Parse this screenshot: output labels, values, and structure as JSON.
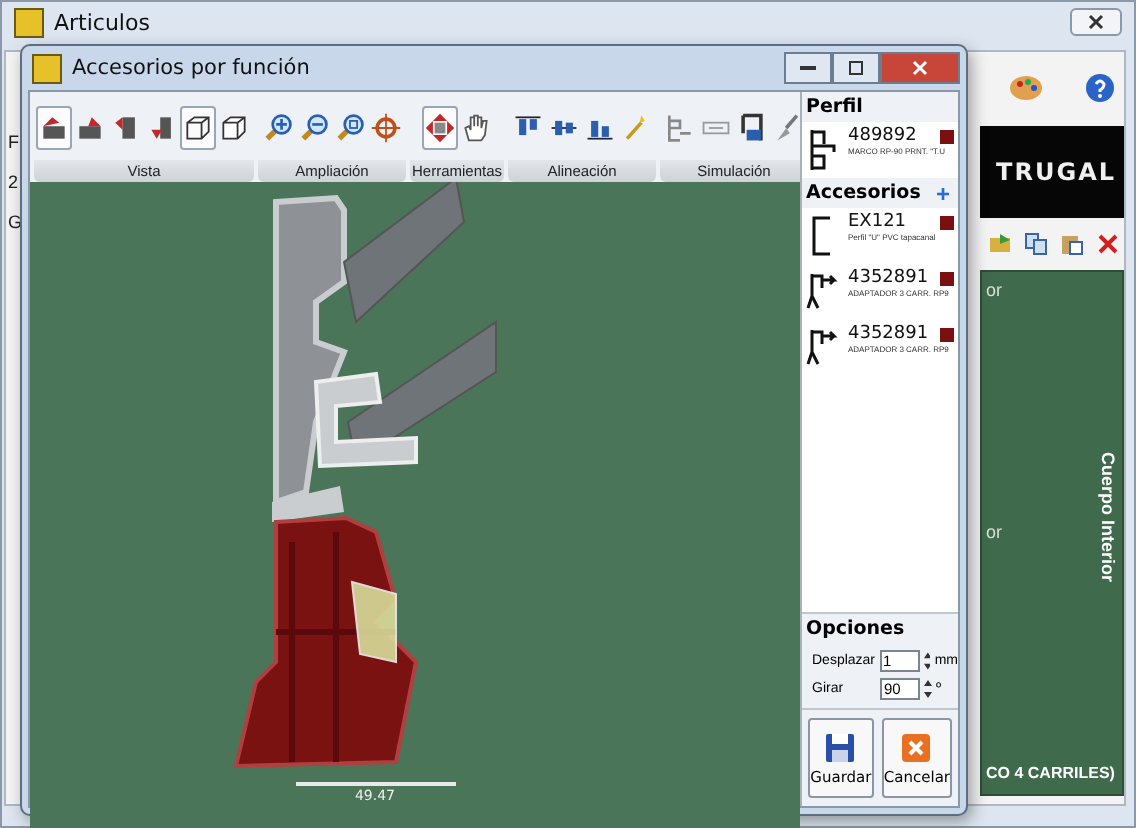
{
  "back_window": {
    "title": "Articulos",
    "left_labels": [
      "F",
      "2",
      "G"
    ],
    "logo": "TRUGAL",
    "panel": {
      "labels": [
        "or",
        "or"
      ],
      "side_title": "Cuerpo Interior",
      "caption": "CO 4 CARRILES)"
    }
  },
  "window": {
    "title": "Accesorios por función"
  },
  "toolbar": [
    {
      "label": "Vista",
      "buttons": [
        {
          "kind": "view-a",
          "selected": true
        },
        {
          "kind": "view-b",
          "selected": false
        },
        {
          "kind": "view-c",
          "selected": false
        },
        {
          "kind": "view-d",
          "selected": false
        },
        {
          "kind": "frame",
          "selected": true
        },
        {
          "kind": "cube",
          "selected": false
        }
      ]
    },
    {
      "label": "Ampliación",
      "buttons": [
        {
          "kind": "zoom-in",
          "selected": false
        },
        {
          "kind": "zoom-out",
          "selected": false
        },
        {
          "kind": "zoom-fit",
          "selected": false
        },
        {
          "kind": "target",
          "selected": false
        }
      ]
    },
    {
      "label": "Herramientas",
      "buttons": [
        {
          "kind": "move",
          "selected": true
        },
        {
          "kind": "hand",
          "selected": false
        }
      ]
    },
    {
      "label": "Alineación",
      "buttons": [
        {
          "kind": "align-top",
          "selected": false
        },
        {
          "kind": "align-mid",
          "selected": false
        },
        {
          "kind": "align-bottom",
          "selected": false
        },
        {
          "kind": "wand",
          "selected": false
        }
      ]
    },
    {
      "label": "Simulación",
      "buttons": [
        {
          "kind": "sim-a",
          "selected": false
        },
        {
          "kind": "sim-b",
          "selected": false
        },
        {
          "kind": "sim-c",
          "selected": false
        },
        {
          "kind": "brush",
          "selected": false
        }
      ]
    }
  ],
  "canvas": {
    "dimension": "49.47"
  },
  "perfil": {
    "title": "Perfil",
    "item": {
      "code": "489892",
      "desc": "MARCO RP-90 PRNT. \"T.U",
      "color": "#7a1010"
    }
  },
  "accesorios": {
    "title": "Accesorios",
    "add_button": "+",
    "items": [
      {
        "kind": "u",
        "code": "EX121",
        "desc": "Perfil \"U\" PVC tapacanal",
        "color": "#7a1010"
      },
      {
        "kind": "adapter",
        "code": "4352891",
        "desc": "ADAPTADOR 3 CARR. RP9",
        "color": "#7a1010"
      },
      {
        "kind": "adapter",
        "code": "4352891",
        "desc": "ADAPTADOR 3 CARR. RP9",
        "color": "#7a1010"
      }
    ]
  },
  "opciones": {
    "title": "Opciones",
    "fields": [
      {
        "label": "Desplazar",
        "value": "1",
        "unit": "mm"
      },
      {
        "label": "Girar",
        "value": "90",
        "unit": "º"
      }
    ]
  },
  "buttons": [
    {
      "kind": "save",
      "label": "Guardar"
    },
    {
      "kind": "cancel",
      "label": "Cancelar"
    }
  ]
}
